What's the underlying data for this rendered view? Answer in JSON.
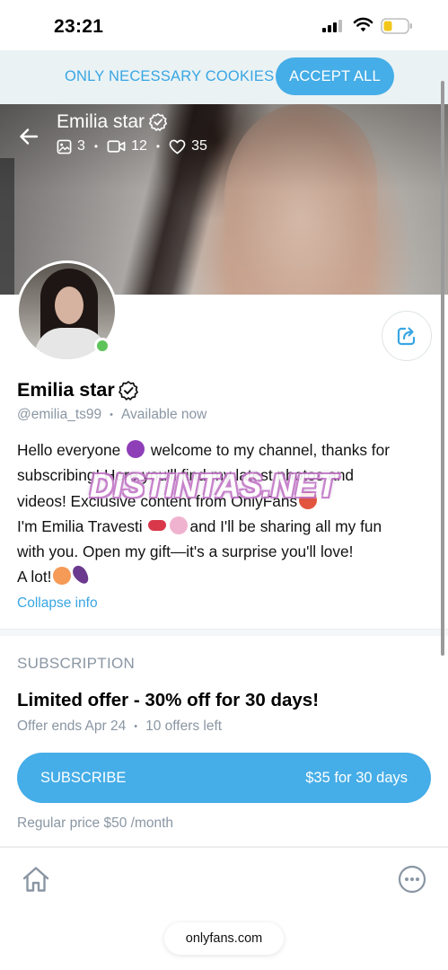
{
  "status_bar": {
    "time": "23:21",
    "signal_icon": "cellular-signal-icon",
    "wifi_icon": "wifi-icon",
    "battery_icon": "battery-low-icon"
  },
  "cookie_bar": {
    "necessary_label": "ONLY NECESSARY COOKIES",
    "accept_label": "ACCEPT ALL"
  },
  "cover": {
    "name": "Emilia star",
    "photos_count": "3",
    "videos_count": "12",
    "likes_count": "35"
  },
  "profile": {
    "name": "Emilia star",
    "handle": "@emilia_ts99",
    "availability": "Available now",
    "online": true,
    "bio_lines": [
      "Hello everyone",
      "welcome to my channel, thanks for",
      "subscribing! Here you'll find my latest photos and",
      "videos! Exclusive content from OnlyFans",
      "I'm Emilia Travesti",
      "and I'll be sharing all my fun",
      "with you. Open my gift—it's a surprise you'll love!",
      "A lot!"
    ],
    "collapse_label": "Collapse info"
  },
  "watermark": "DISTINTAS.NET",
  "subscription": {
    "section_title": "SUBSCRIPTION",
    "offer_title": "Limited offer - 30% off for 30 days!",
    "offer_ends": "Offer ends Apr 24",
    "offers_left": "10 offers left",
    "subscribe_label": "SUBSCRIBE",
    "price_label": "$35 for 30 days",
    "regular_price": "Regular price $50 /month"
  },
  "bottom_nav": {
    "url": "onlyfans.com"
  },
  "colors": {
    "accent": "#45ade7",
    "link": "#38a6e3",
    "muted": "#8a96a3",
    "online": "#5ec45a"
  }
}
